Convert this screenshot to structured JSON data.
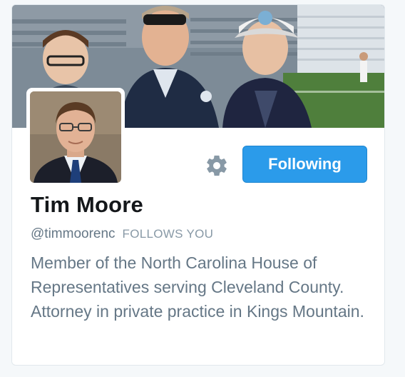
{
  "profile": {
    "name": "Tim Moore",
    "handle": "@timmoorenc",
    "follows_you": "FOLLOWS YOU",
    "bio": "Member of the North Carolina House of Representatives serving Cleveland County. Attorney in private practice in Kings Mountain."
  },
  "actions": {
    "settings_icon": "gear-icon",
    "follow_label": "Following"
  },
  "colors": {
    "accent": "#2b9bea",
    "name_text": "#14171a",
    "secondary_text": "#657786",
    "card_border": "#e1e8ed"
  }
}
